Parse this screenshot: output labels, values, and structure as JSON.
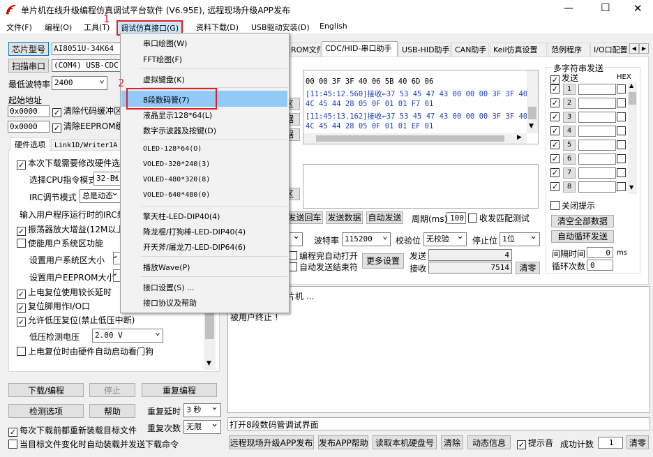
{
  "window": {
    "title": "单片机在线升级编程仿真调试平台软件 (V6.95E), 远程现场升级APP发布",
    "controls": {
      "minimize": "—",
      "maximize": "☐",
      "close": "✕"
    }
  },
  "menubar": [
    "文件(F)",
    "编程(O)",
    "工具(T)",
    "调试仿真接口(G)",
    "资料下载(D)",
    "USB驱动安装(D)",
    "English"
  ],
  "left": {
    "chip_button": "芯片型号",
    "chip_value": "AI8051U-34K64",
    "scan_button": "扫描串口",
    "port_value": "(COM4) USB-CDC,(",
    "baud_label": "最低波特率",
    "baud_value": "2400",
    "start_addr_label": "起始地址",
    "addr1": "0x0000",
    "clear_code": "清除代码缓冲区",
    "addr2": "0x0000",
    "clear_eeprom": "清除EEPROM缓冲",
    "tabs": [
      "硬件选项",
      "Link1D/Writer1A"
    ],
    "options": {
      "modify_hw": "本次下载需要修改硬件选",
      "cpu_label": "选择CPU指令模式",
      "cpu_value": "32-Bi",
      "irc_label": "IRC调节模式",
      "irc_value": "总是动态",
      "irc_freq": "输入用户程序运行时的IRC频",
      "osc": "振荡器放大增益(12M以上",
      "user_sys": "使能用户系统区功能",
      "user_sys_size": "设置用户系统区大小",
      "user_eeprom": "设置用户EEPROM大小",
      "power_delay": "上电复位使用较长延时",
      "reset_io": "复位脚用作I/O口",
      "low_volt_reset": "允许低压复位(禁止低压中断)",
      "low_volt_label": "低压检测电压",
      "low_volt_value": "2.00 V",
      "watchdog": "上电复位时由硬件自动启动看门狗"
    },
    "download_button": "下载/编程",
    "stop_button": "停止",
    "reprogram_button": "重复编程",
    "detect_button": "检测选项",
    "help_button": "帮助",
    "repeat_delay_label": "重复延时",
    "repeat_delay_value": "3 秒",
    "repeat_count_label": "重复次数",
    "repeat_count_value": "无限",
    "reload_each": "每次下载前都重新装载目标文件",
    "auto_load": "当目标文件变化时自动装载并发送下载命令"
  },
  "tabs_right": [
    "ROM文件",
    "CDC/HID-串口助手",
    "USB-HID助手",
    "CAN助手",
    "Keil仿真设置",
    "范例程序",
    "I/O口配置"
  ],
  "receive_lines": [
    "            00 00 3F 3F 40 06 5B 40 6D 06",
    "[11:45:12.560]接收←37 53 45 47 43 00 00 00 3F 3F 40",
    "            4C 45 44 28 05 0F 01 01 F7 01",
    "[11:45:13.162]接收←37 53 45 47 43 00 00 00 3F 3F 40",
    "            4C 45 44 28 05 0F 01 01 EF 01"
  ],
  "left_partial": {
    "clear1": "区",
    "data1": "据",
    "data2": "据",
    "clear2": "区"
  },
  "send_controls": {
    "send_return": "发送回车",
    "send_data": "发送数据",
    "auto_send": "自动发送",
    "period_label": "周期(ms)",
    "period_value": "100",
    "recv_match": "收发匹配测试"
  },
  "serial": {
    "baud_label": "波特率",
    "baud_value": "115200",
    "parity_label": "校验位",
    "parity_value": "无校验",
    "stop_label": "停止位",
    "stop_value": "1位",
    "open_after": "编程完自动打开",
    "close_after": "自动发送结束符",
    "more": "更多设置",
    "send_label": "发送",
    "send_count": "4",
    "recv_label": "接收",
    "recv_count": "7514",
    "clear": "清零"
  },
  "multi": {
    "title": "多字符串发送",
    "send_col": "发送",
    "hex_col": "HEX",
    "rows": [
      "1",
      "2",
      "3",
      "4",
      "5",
      "6",
      "7",
      "8"
    ],
    "close_hint": "关闭提示",
    "clear_all": "清空全部数据",
    "auto_loop": "自动循环发送",
    "interval_label": "间隔时间",
    "interval_value": "0",
    "interval_unit": "ms",
    "loop_label": "循环次数",
    "loop_value": "0"
  },
  "log": [
    "片机 ...",
    "被用户终止 !"
  ],
  "status_text": "打开8段数码管调试界面",
  "bottom": {
    "remote": "远程现场升级APP发布",
    "publish_help": "发布APP帮助",
    "read_disk": "读取本机硬盘号",
    "clear": "清除",
    "anim": "动态信息",
    "beep": "提示音",
    "success_label": "成功计数",
    "success_value": "1",
    "clear2": "清零"
  },
  "dropdown": [
    "串口绘图(W)",
    "FFT绘图(F)",
    "虚拟键盘(K)",
    "8段数码管(7)",
    "液晶显示128*64(L)",
    "数字示波器及按键(D)",
    "OLED-128*64(O)",
    "VOLED-320*240(3)",
    "VOLED-480*320(8)",
    "VOLED-640*480(0)",
    "擎天柱-LED-DIP40(4)",
    "降龙棍/打狗棒-LED-DIP40(4)",
    "开天斧/屠龙刀-LED-DIP64(6)",
    "播放Wave(P)",
    "接口设置(S) ...",
    "接口协议及帮助"
  ],
  "annotations": {
    "step1": "1",
    "step2": "2"
  },
  "colors": {
    "highlight": "#91c9f7",
    "annotation": "#e02020",
    "menu_select": "#cce8ff"
  }
}
